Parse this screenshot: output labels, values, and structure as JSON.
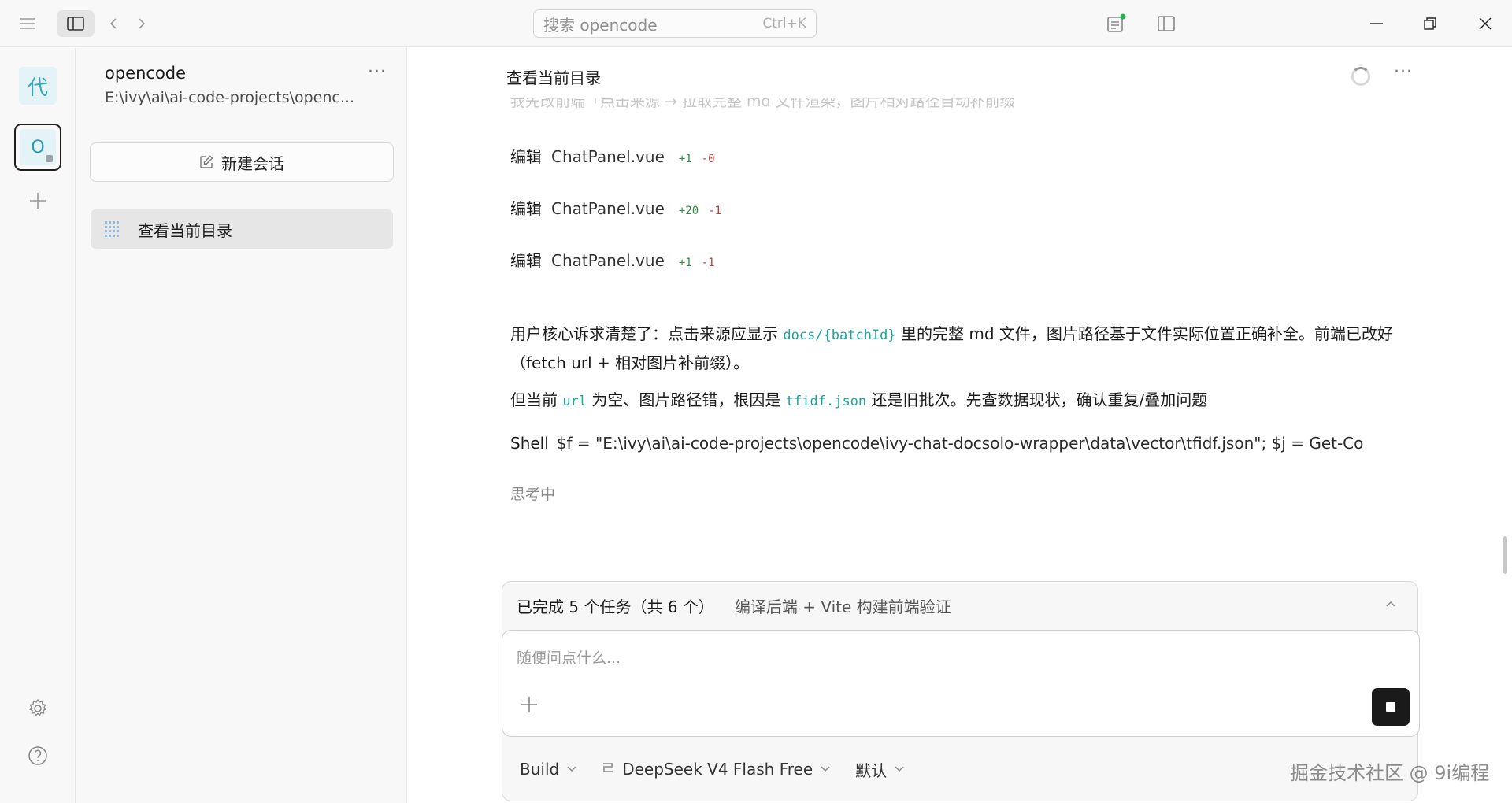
{
  "titlebar": {
    "search_placeholder": "搜索 opencode",
    "search_shortcut": "Ctrl+K",
    "icons": [
      "menu-icon",
      "sidebar-toggle-icon",
      "back-icon",
      "forward-icon",
      "review-panel-icon",
      "layout-panel-icon",
      "minimize-icon",
      "restore-icon",
      "close-icon"
    ],
    "status_dot_color": "#22b24c"
  },
  "rail": {
    "project_initial": "代",
    "current_initial": "O"
  },
  "sidebar": {
    "project_name": "opencode",
    "project_path": "E:\\ivy\\ai\\ai-code-projects\\openc...",
    "new_session_label": "新建会话",
    "sessions": [
      {
        "title": "查看当前目录"
      }
    ]
  },
  "main": {
    "title": "查看当前目录",
    "faded_text": "我先改前端「点击来源 → 拉取完整 md 文件渲染，图片相对路径自动补前缀",
    "edits": [
      {
        "verb": "编辑",
        "file": "ChatPanel.vue",
        "added": "+1",
        "removed": "-0"
      },
      {
        "verb": "编辑",
        "file": "ChatPanel.vue",
        "added": "+20",
        "removed": "-1"
      },
      {
        "verb": "编辑",
        "file": "ChatPanel.vue",
        "added": "+1",
        "removed": "-1"
      }
    ],
    "para1": {
      "a": "用户核心诉求清楚了：点击来源应显示 ",
      "code": "docs/{batchId}",
      "b": " 里的完整 md 文件，图片路径基于文件实际位置正确补全。前端已改好（fetch url + 相对图片补前缀）。"
    },
    "para2": {
      "a": "但当前 ",
      "code1": "url",
      "b": " 为空、图片路径错，根因是 ",
      "code2": "tfidf.json",
      "c": " 还是旧批次。先查数据现状，确认重复/叠加问题"
    },
    "shell": {
      "label": "Shell",
      "command": "$f = \"E:\\ivy\\ai\\ai-code-projects\\opencode\\ivy-chat-docsolo-wrapper\\data\\vector\\tfidf.json\"; $j = Get-Co"
    },
    "thinking": "思考中"
  },
  "composer": {
    "tasks_count": "已完成 5 个任务（共 6 个）",
    "tasks_desc": "编译后端 + Vite 构建前端验证",
    "input_placeholder": "随便问点什么...",
    "agent": "Build",
    "model": "DeepSeek V4 Flash Free",
    "variant": "默认"
  },
  "watermark": "掘金技术社区 @ 9i编程"
}
